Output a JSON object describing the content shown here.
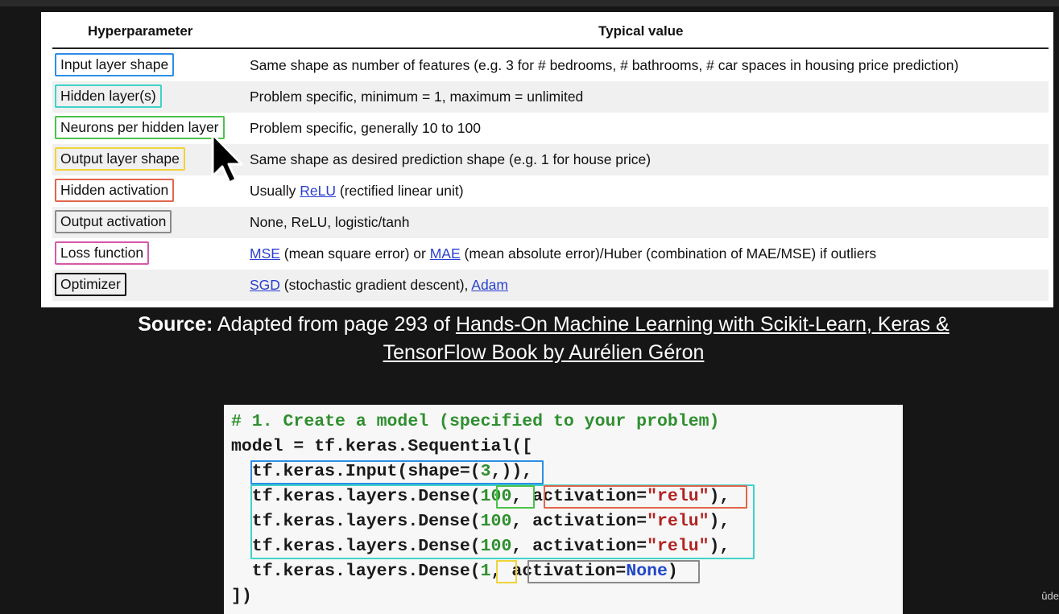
{
  "table": {
    "headers": {
      "hyperparameter": "Hyperparameter",
      "typical_value": "Typical value"
    },
    "rows": [
      {
        "hyperparameter": "Input layer shape",
        "typical_value": "Same shape as number of features (e.g. 3 for # bedrooms, # bathrooms, # car spaces in housing price prediction)",
        "box_color": "#2d8ee6"
      },
      {
        "hyperparameter": "Hidden layer(s)",
        "typical_value": "Problem specific, minimum = 1, maximum = unlimited",
        "box_color": "#3fd3c9"
      },
      {
        "hyperparameter": "Neurons per hidden layer",
        "typical_value": "Problem specific, generally 10 to 100",
        "box_color": "#4cc24c"
      },
      {
        "hyperparameter": "Output layer shape",
        "typical_value": "Same shape as desired prediction shape (e.g. 1 for house price)",
        "box_color": "#f0d33a"
      },
      {
        "hyperparameter": "Hidden activation",
        "typical_value_link": "ReLU",
        "typical_value_pre": "Usually ",
        "typical_value_post": " (rectified linear unit)",
        "box_color": "#e0664d"
      },
      {
        "hyperparameter": "Output activation",
        "typical_value": "None, ReLU, logistic/tanh",
        "box_color": "#8a8a8a"
      },
      {
        "hyperparameter": "Loss function",
        "link1": "MSE",
        "mid1": " (mean square error) or ",
        "link2": "MAE",
        "mid2": " (mean absolute error)/Huber (combination of MAE/MSE) if outliers",
        "box_color": "#d659a8"
      },
      {
        "hyperparameter": "Optimizer",
        "link1": "SGD",
        "mid1": " (stochastic gradient descent), ",
        "link2": "Adam",
        "box_color": "#111111"
      }
    ]
  },
  "source": {
    "label": "Source:",
    "prefix": " Adapted from page 293 of ",
    "link_line1": "Hands-On Machine Learning with Scikit-Learn, Keras &",
    "link_line2": "TensorFlow Book by Aurélien Géron"
  },
  "code": {
    "line1": "# 1. Create a model (specified to your problem)",
    "line2": "model = tf.keras.Sequential([",
    "line3_a": "  tf.keras.Input(shape=(",
    "line3_num": "3",
    "line3_b": ",)),",
    "dense_prefix": "  tf.keras.layers.Dense(",
    "dense_units": "100",
    "act_kw": ", activation=",
    "act_val": "\"relu\"",
    "dense_close": "),",
    "line7_units": "1",
    "line7_act": "activation=",
    "line7_none": "None",
    "line7_close": ")",
    "line8": "])"
  },
  "watermark": "ûde"
}
